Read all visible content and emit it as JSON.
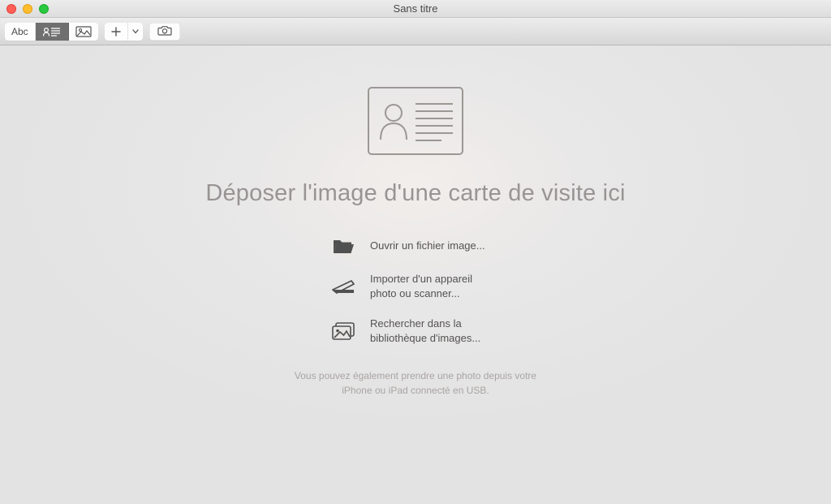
{
  "window": {
    "title": "Sans titre"
  },
  "toolbar": {
    "text_mode_label": "Abc"
  },
  "main": {
    "headline": "Déposer l'image d'une carte de visite ici",
    "actions": {
      "open_file": "Ouvrir un fichier image...",
      "import_device": "Importer d'un appareil photo ou scanner...",
      "search_library": "Rechercher dans la bibliothèque d'images..."
    },
    "footer_note": "Vous pouvez également prendre une photo depuis votre iPhone ou iPad connecté en USB."
  }
}
